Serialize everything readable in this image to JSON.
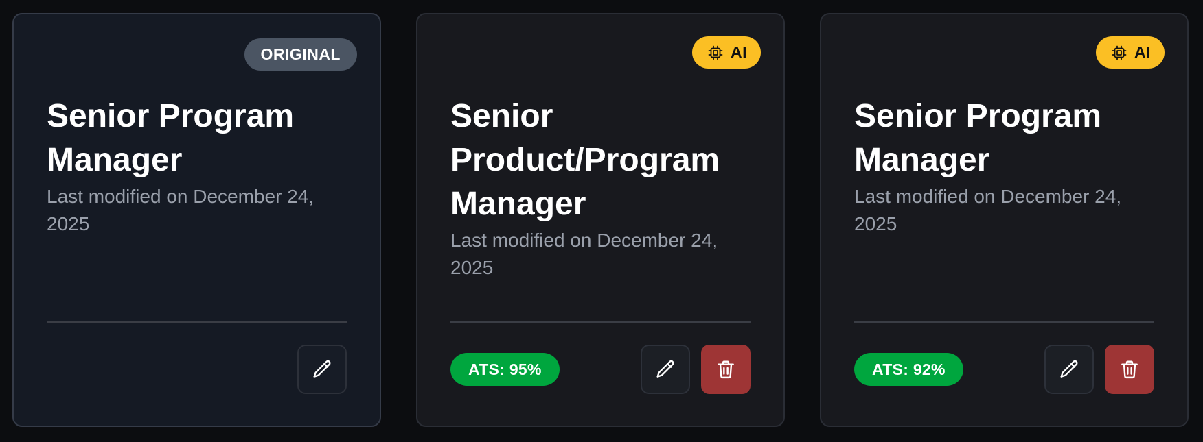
{
  "cards": [
    {
      "badge": "ORIGINAL",
      "title": "Senior Program Manager",
      "modified": "Last modified on December 24, 2025",
      "ats": null,
      "actions": [
        "edit"
      ]
    },
    {
      "badge": "AI",
      "badge_icon": "cpu-chip-icon",
      "title": "Senior Product/Program Manager",
      "modified": "Last modified on December 24, 2025",
      "ats": "ATS: 95%",
      "actions": [
        "edit",
        "delete"
      ]
    },
    {
      "badge": "AI",
      "badge_icon": "cpu-chip-icon",
      "title": "Senior Program Manager",
      "modified": "Last modified on December 24, 2025",
      "ats": "ATS: 92%",
      "actions": [
        "edit",
        "delete"
      ]
    }
  ],
  "colors": {
    "background": "#0c0d10",
    "original_card": "#151a24",
    "ai_card": "#18191e",
    "original_badge": "#4b5563",
    "ai_badge": "#fbbf24",
    "ats_badge": "#00a63e",
    "delete_button": "#9e3535",
    "muted_text": "#9aa0ab"
  },
  "icons": {
    "edit": "pencil-icon",
    "delete": "trash-icon",
    "ai": "cpu-chip-icon"
  }
}
